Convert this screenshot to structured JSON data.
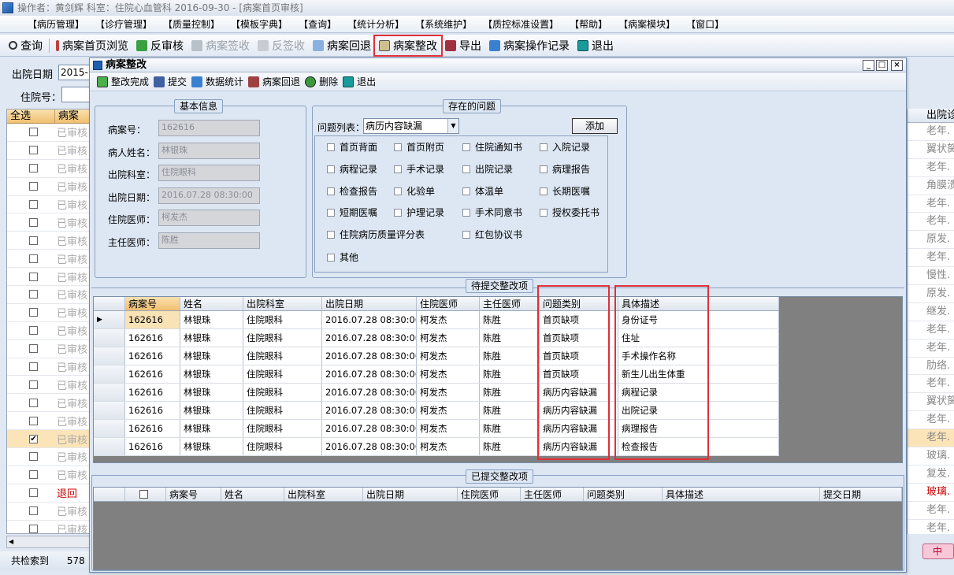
{
  "titlebar": {
    "text": "操作者：黄剑辉   科室：住院心血管科   2016-09-30 - [病案首页审核]"
  },
  "menu": [
    "【病历管理】",
    "【诊疗管理】",
    "【质量控制】",
    "【模板字典】",
    "【查询】",
    "【统计分析】",
    "【系统维护】",
    "【质控标准设置】",
    "【帮助】",
    "【病案模块】",
    "【窗口】"
  ],
  "toolbar": {
    "query": "查询",
    "browse": "病案首页浏览",
    "reverse": "反审核",
    "sign_receive": "病案签收",
    "unsign": "反签收",
    "return": "病案回退",
    "rectify": "病案整改",
    "export": "导出",
    "op_record": "病案操作记录",
    "exit": "退出"
  },
  "bg": {
    "discharge_date_label": "出院日期",
    "discharge_date_value": "2015-",
    "inpatient_no_label": "住院号：",
    "select_all": "全选",
    "col2": "病案",
    "right_col": "出院诊",
    "rows": [
      {
        "status": "已审核",
        "diag": "老年."
      },
      {
        "status": "已审核",
        "diag": "翼状胬"
      },
      {
        "status": "已审核",
        "diag": "老年."
      },
      {
        "status": "已审核",
        "diag": "角膜溃"
      },
      {
        "status": "已审核",
        "diag": "老年."
      },
      {
        "status": "已审核",
        "diag": "老年."
      },
      {
        "status": "已审核",
        "diag": "原发."
      },
      {
        "status": "已审核",
        "diag": "老年."
      },
      {
        "status": "已审核",
        "diag": "慢性."
      },
      {
        "status": "已审核",
        "diag": "原发."
      },
      {
        "status": "已审核",
        "diag": "继发."
      },
      {
        "status": "已审核",
        "diag": "老年."
      },
      {
        "status": "已审核",
        "diag": "老年."
      },
      {
        "status": "已审核",
        "diag": "肋络."
      },
      {
        "status": "已审核",
        "diag": "老年."
      },
      {
        "status": "已审核",
        "diag": "翼状胬"
      },
      {
        "status": "已审核",
        "diag": "老年."
      },
      {
        "status": "已审核",
        "diag": "老年.",
        "checked": true
      },
      {
        "status": "已审核",
        "diag": "玻璃."
      },
      {
        "status": "已审核",
        "diag": "复发."
      },
      {
        "status": "退回",
        "diag": "玻璃."
      },
      {
        "status": "已审核",
        "diag": "老年."
      },
      {
        "status": "已审核",
        "diag": "老年."
      }
    ],
    "total_label": "共检索到",
    "total_count": "578",
    "mid_button": "中"
  },
  "dialog": {
    "title": "病案整改",
    "tools": {
      "complete": "整改完成",
      "submit": "提交",
      "stats": "数据统计",
      "return": "病案回退",
      "delete": "删除",
      "exit": "退出"
    },
    "basic": {
      "title": "基本信息",
      "fields": [
        {
          "label": "病案号：",
          "value": "162616"
        },
        {
          "label": "病人姓名：",
          "value": "林银珠"
        },
        {
          "label": "出院科室：",
          "value": "住院眼科"
        },
        {
          "label": "出院日期：",
          "value": "2016.07.28 08:30:00"
        },
        {
          "label": "住院医师：",
          "value": "柯发杰"
        },
        {
          "label": "主任医师：",
          "value": "陈胜"
        }
      ]
    },
    "problems": {
      "title": "存在的问题",
      "list_label": "问题列表：",
      "list_value": "病历内容缺漏",
      "add": "添加",
      "items": [
        "首页背面",
        "首页附页",
        "住院通知书",
        "入院记录",
        "病程记录",
        "手术记录",
        "出院记录",
        "病理报告",
        "检查报告",
        "化验单",
        "体温单",
        "长期医嘱",
        "短期医嘱",
        "护理记录",
        "手术同意书",
        "授权委托书",
        "住院病历质量评分表",
        "红包协议书",
        "其他"
      ]
    },
    "pending": {
      "title": "待提交整改项",
      "headers": [
        "病案号",
        "姓名",
        "出院科室",
        "出院日期",
        "住院医师",
        "主任医师",
        "问题类别",
        "具体描述"
      ],
      "rows": [
        [
          "162616",
          "林银珠",
          "住院眼科",
          "2016.07.28 08:30:00",
          "柯发杰",
          "陈胜",
          "首页缺项",
          "身份证号"
        ],
        [
          "162616",
          "林银珠",
          "住院眼科",
          "2016.07.28 08:30:00",
          "柯发杰",
          "陈胜",
          "首页缺项",
          "住址"
        ],
        [
          "162616",
          "林银珠",
          "住院眼科",
          "2016.07.28 08:30:00",
          "柯发杰",
          "陈胜",
          "首页缺项",
          "手术操作名称"
        ],
        [
          "162616",
          "林银珠",
          "住院眼科",
          "2016.07.28 08:30:00",
          "柯发杰",
          "陈胜",
          "首页缺项",
          "新生儿出生体重"
        ],
        [
          "162616",
          "林银珠",
          "住院眼科",
          "2016.07.28 08:30:00",
          "柯发杰",
          "陈胜",
          "病历内容缺漏",
          "病程记录"
        ],
        [
          "162616",
          "林银珠",
          "住院眼科",
          "2016.07.28 08:30:00",
          "柯发杰",
          "陈胜",
          "病历内容缺漏",
          "出院记录"
        ],
        [
          "162616",
          "林银珠",
          "住院眼科",
          "2016.07.28 08:30:00",
          "柯发杰",
          "陈胜",
          "病历内容缺漏",
          "病理报告"
        ],
        [
          "162616",
          "林银珠",
          "住院眼科",
          "2016.07.28 08:30:00",
          "柯发杰",
          "陈胜",
          "病历内容缺漏",
          "检查报告"
        ]
      ]
    },
    "submitted": {
      "title": "已提交整改项",
      "headers": [
        "病案号",
        "姓名",
        "出院科室",
        "出院日期",
        "住院医师",
        "主任医师",
        "问题类别",
        "具体描述",
        "提交日期"
      ]
    }
  }
}
